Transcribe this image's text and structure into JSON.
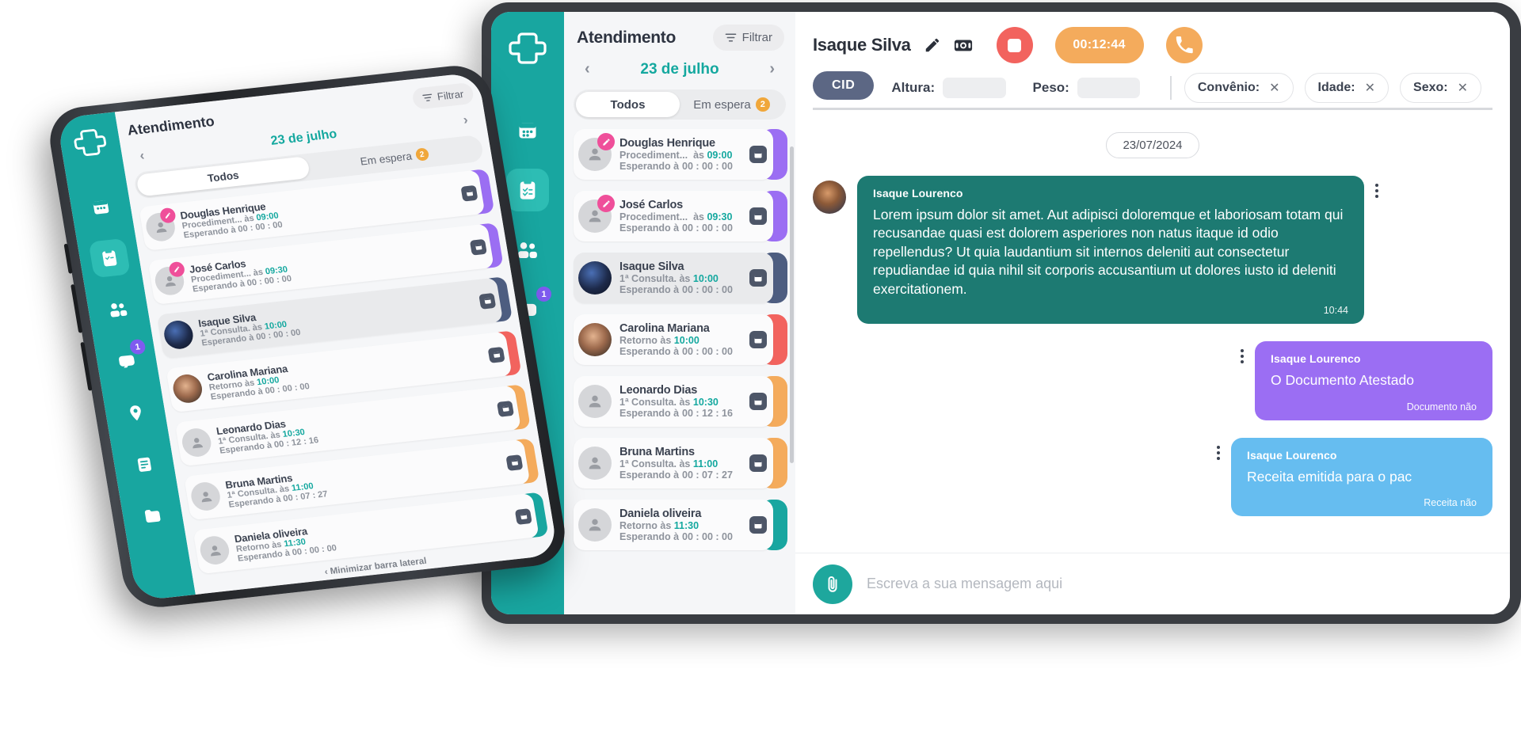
{
  "brand": {
    "teal": "#18a6a0",
    "teal_light": "#2dbdb4",
    "accent_pink": "#ef4f9a",
    "orange": "#f4ab5c",
    "red": "#f2635e",
    "purple": "#9b6ef3",
    "blue": "#66bdf0",
    "dark_bubble": "#1d7a72"
  },
  "sidebar": {
    "logo_name": "medical-cross-logo",
    "items": [
      {
        "icon": "calendar-icon",
        "name": "sidebar-item-calendar",
        "active": false,
        "badge": ""
      },
      {
        "icon": "clipboard-check-icon",
        "name": "sidebar-item-attendance",
        "active": true,
        "badge": ""
      },
      {
        "icon": "people-icon",
        "name": "sidebar-item-patients",
        "active": false,
        "badge": ""
      },
      {
        "icon": "chat-icon",
        "name": "sidebar-item-messages",
        "active": false,
        "badge": "1"
      },
      {
        "icon": "pin-icon",
        "name": "sidebar-item-location",
        "active": false,
        "badge": ""
      },
      {
        "icon": "note-icon",
        "name": "sidebar-item-notes",
        "active": false,
        "badge": ""
      },
      {
        "icon": "folder-icon",
        "name": "sidebar-item-files",
        "active": false,
        "badge": ""
      }
    ]
  },
  "list_panel": {
    "title": "Atendimento",
    "filter_label": "Filtrar",
    "date": "23 de julho",
    "prev_arrow": "‹",
    "next_arrow": "›",
    "tabs": [
      {
        "label": "Todos",
        "active": true,
        "badge": ""
      },
      {
        "label": "Em espera",
        "active": false,
        "badge": "2"
      }
    ],
    "minimize_label": "‹ Minimizar barra lateral",
    "patients": [
      {
        "name": "Douglas Henrique",
        "type": "Procediment...",
        "at_label": "às",
        "time": "09:00",
        "waiting_label": "Esperando à",
        "waiting": "00 : 00 : 00",
        "stripe": "#9b6ef3",
        "avatar": "person-placeholder",
        "has_edit": true,
        "selected": false
      },
      {
        "name": "José Carlos",
        "type": "Procediment...",
        "at_label": "às",
        "time": "09:30",
        "waiting_label": "Esperando à",
        "waiting": "00 : 00 : 00",
        "stripe": "#9b6ef3",
        "avatar": "person-placeholder",
        "has_edit": true,
        "selected": false
      },
      {
        "name": "Isaque Silva",
        "type": "1ª Consulta.",
        "at_label": "às",
        "time": "10:00",
        "waiting_label": "Esperando à",
        "waiting": "00 : 00 : 00",
        "stripe": "#4d5d80",
        "avatar": "photo-1",
        "has_edit": false,
        "selected": true
      },
      {
        "name": "Carolina Mariana",
        "type": "Retorno",
        "at_label": "às",
        "time": "10:00",
        "waiting_label": "Esperando à",
        "waiting": "00 : 00 : 00",
        "stripe": "#f2635e",
        "avatar": "photo-2",
        "has_edit": false,
        "selected": false
      },
      {
        "name": "Leonardo Dias",
        "type": "1ª Consulta.",
        "at_label": "às",
        "time": "10:30",
        "waiting_label": "Esperando à",
        "waiting": "00 : 12 : 16",
        "stripe": "#f4ab5c",
        "avatar": "person-placeholder",
        "has_edit": false,
        "selected": false
      },
      {
        "name": "Bruna Martins",
        "type": "1ª Consulta.",
        "at_label": "às",
        "time": "11:00",
        "waiting_label": "Esperando à",
        "waiting": "00 : 07 : 27",
        "stripe": "#f4ab5c",
        "avatar": "person-placeholder",
        "has_edit": false,
        "selected": false
      },
      {
        "name": "Daniela oliveira",
        "type": "Retorno",
        "at_label": "às",
        "time": "11:30",
        "waiting_label": "Esperando à",
        "waiting": "00 : 00 : 00",
        "stripe": "#18a6a0",
        "avatar": "person-placeholder",
        "has_edit": false,
        "selected": false
      }
    ]
  },
  "chat": {
    "patient_name": "Isaque Silva",
    "edit_icon": "pencil-icon",
    "camera_icon": "camera-icon",
    "record_icon": "stop-record-icon",
    "timer": "00:12:44",
    "call_icon": "phone-icon",
    "cid_label": "CID",
    "fields": [
      {
        "label": "Altura:",
        "value": ""
      },
      {
        "label": "Peso:",
        "value": ""
      }
    ],
    "tags": [
      {
        "label": "Convênio:",
        "close": "✕"
      },
      {
        "label": "Idade:",
        "close": "✕"
      },
      {
        "label": "Sexo:",
        "close": "✕"
      }
    ],
    "date_divider": "23/07/2024",
    "messages": [
      {
        "side": "left",
        "color": "teal",
        "sender": "Isaque Lourenco",
        "text": "Lorem ipsum dolor sit amet. Aut adipisci doloremque et laboriosam totam qui recusandae quasi est dolorem asperiores non natus itaque id odio repellendus? Ut quia laudantium sit internos deleniti aut consectetur repudiandae id quia nihil sit corporis accusantium ut dolores iusto id deleniti exercitationem.",
        "time": "10:44",
        "footer": ""
      },
      {
        "side": "right",
        "color": "purple",
        "sender": "Isaque Lourenco",
        "text": "O Documento Atestado",
        "time": "",
        "footer": "Documento não"
      },
      {
        "side": "right",
        "color": "blue",
        "sender": "Isaque Lourenco",
        "text": "Receita emitida para o pac",
        "time": "",
        "footer": "Receita não"
      }
    ],
    "composer": {
      "attach_icon": "paperclip-icon",
      "placeholder": "Escreva a sua mensagem aqui"
    }
  }
}
